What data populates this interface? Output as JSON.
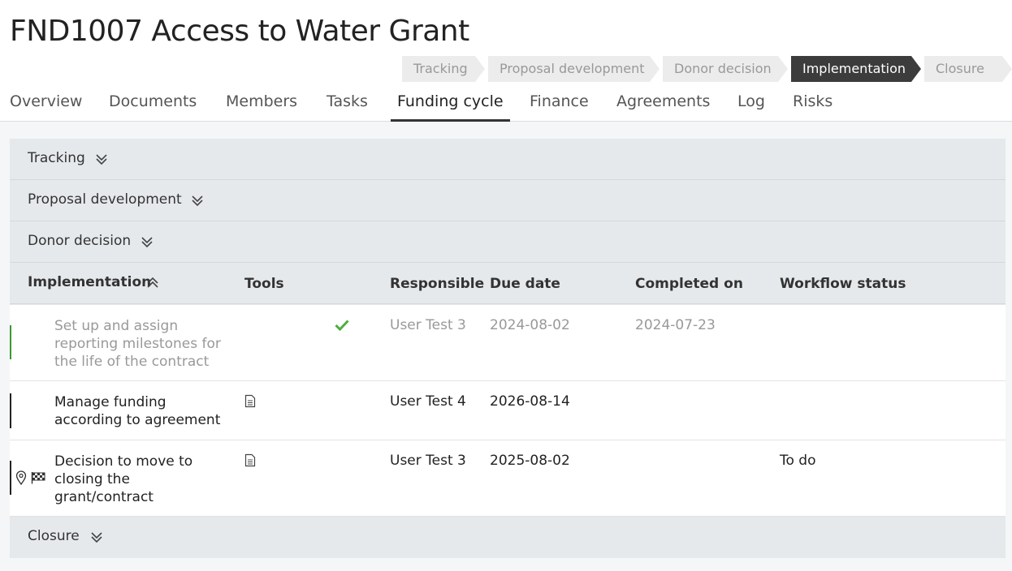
{
  "page_title": "FND1007 Access to Water Grant",
  "stages": [
    {
      "label": "Tracking"
    },
    {
      "label": "Proposal development"
    },
    {
      "label": "Donor decision"
    },
    {
      "label": "Implementation"
    },
    {
      "label": "Closure"
    }
  ],
  "active_stage": "Implementation",
  "tabs": [
    {
      "label": "Overview"
    },
    {
      "label": "Documents"
    },
    {
      "label": "Members"
    },
    {
      "label": "Tasks"
    },
    {
      "label": "Funding cycle"
    },
    {
      "label": "Finance"
    },
    {
      "label": "Agreements"
    },
    {
      "label": "Log"
    },
    {
      "label": "Risks"
    }
  ],
  "active_tab": "Funding cycle",
  "sections": {
    "tracking": "Tracking",
    "proposal": "Proposal development",
    "donor": "Donor decision",
    "implementation": "Implementation",
    "closure": "Closure"
  },
  "columns": {
    "tools": "Tools",
    "responsible": "Responsible",
    "due_date": "Due date",
    "completed_on": "Completed on",
    "workflow_status": "Workflow status"
  },
  "rows": [
    {
      "task": "Set up and assign reporting milestones for the life of the contract",
      "responsible": "User Test 3",
      "due_date": "2024-08-02",
      "completed_on": "2024-07-23",
      "workflow_status": "",
      "completed": true
    },
    {
      "task": "Manage funding according to agreement",
      "responsible": "User Test 4",
      "due_date": "2026-08-14",
      "completed_on": "",
      "workflow_status": ""
    },
    {
      "task": "Decision to move to closing the grant/contract",
      "responsible": "User Test 3",
      "due_date": "2025-08-02",
      "completed_on": "",
      "workflow_status": "To do"
    }
  ],
  "colors": {
    "complete_check": "#4caf3c",
    "complete_bar": "#3a9a2e",
    "active_stage_bg": "#3c3c3c",
    "section_bg": "#e6e9ec"
  },
  "icons": [
    "chevron-double-down-icon",
    "chevron-double-up-icon",
    "check-icon",
    "document-icon",
    "location-pin-icon",
    "checkered-flag-icon"
  ]
}
